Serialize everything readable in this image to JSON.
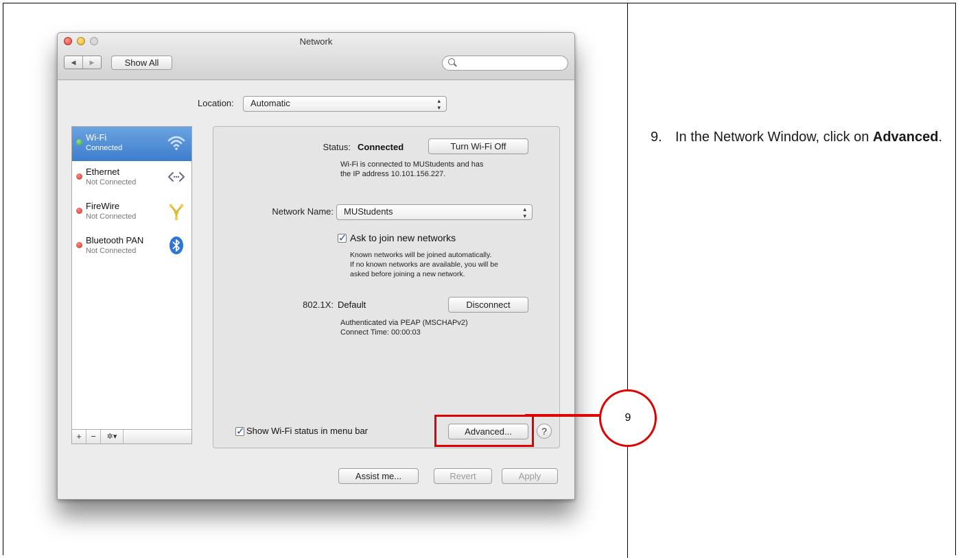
{
  "window": {
    "title": "Network",
    "show_all_label": "Show All",
    "nav_back": "◀",
    "nav_forward": "▶"
  },
  "location": {
    "label": "Location:",
    "value": "Automatic"
  },
  "services": [
    {
      "name": "Wi-Fi",
      "status": "Connected",
      "state": "green",
      "icon": "wifi-icon"
    },
    {
      "name": "Ethernet",
      "status": "Not Connected",
      "state": "red",
      "icon": "ethernet-icon"
    },
    {
      "name": "FireWire",
      "status": "Not Connected",
      "state": "red",
      "icon": "firewire-icon"
    },
    {
      "name": "Bluetooth PAN",
      "status": "Not Connected",
      "state": "red",
      "icon": "bluetooth-icon"
    }
  ],
  "sidebar_toolbar": {
    "add": "+",
    "remove": "−",
    "action": "✲▾"
  },
  "detail": {
    "status_label": "Status:",
    "status_value": "Connected",
    "turn_off_label": "Turn Wi-Fi Off",
    "status_desc_1": "Wi-Fi is connected to MUStudents and has",
    "status_desc_2": "the IP address 10.101.156.227.",
    "network_name_label": "Network Name:",
    "network_name_value": "MUStudents",
    "ask_join_label": "Ask to join new networks",
    "ask_desc_1": "Known networks will be joined automatically.",
    "ask_desc_2": "If no known networks are available, you will be",
    "ask_desc_3": "asked before joining a new network.",
    "dot1x_label": "802.1X:",
    "dot1x_value": "Default",
    "disconnect_label": "Disconnect",
    "auth_desc_1": "Authenticated via PEAP (MSCHAPv2)",
    "auth_desc_2": "Connect Time: 00:00:03",
    "show_status_label": "Show Wi-Fi status in menu bar",
    "advanced_label": "Advanced...",
    "help_label": "?"
  },
  "footer": {
    "assist_label": "Assist me...",
    "revert_label": "Revert",
    "apply_label": "Apply"
  },
  "callout": {
    "number": "9"
  },
  "instruction": {
    "number": "9.",
    "text_before": "In the Network Window, click on ",
    "text_bold": "Advanced",
    "text_after": "."
  }
}
